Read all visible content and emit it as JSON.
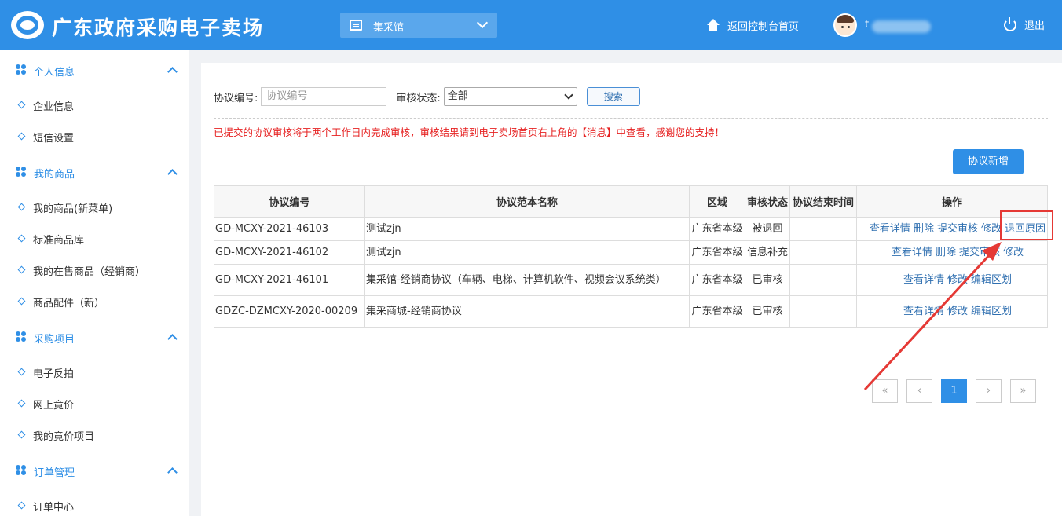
{
  "header": {
    "site_title": "广东政府采购电子卖场",
    "market_select": "集采馆",
    "home_link": "返回控制台首页",
    "username": "t",
    "logout": "退出"
  },
  "sidebar": {
    "groups": [
      {
        "title": "个人信息",
        "items": [
          "企业信息",
          "短信设置"
        ]
      },
      {
        "title": "我的商品",
        "items": [
          "我的商品(新菜单)",
          "标准商品库",
          "我的在售商品（经销商）",
          "商品配件（新）"
        ]
      },
      {
        "title": "采购项目",
        "items": [
          "电子反拍",
          "网上竟价",
          "我的竟价项目"
        ]
      },
      {
        "title": "订单管理",
        "items": [
          "订单中心"
        ]
      }
    ]
  },
  "filter": {
    "agreement_no_label": "协议编号:",
    "agreement_no_placeholder": "协议编号",
    "status_label": "审核状态:",
    "status_value": "全部",
    "search_button": "搜索"
  },
  "notice": "已提交的协议审核将于两个工作日内完成审核，审核结果请到电子卖场首页右上角的【消息】中查看，感谢您的支持！",
  "add_button": "协议新增",
  "table": {
    "headers": [
      "协议编号",
      "协议范本名称",
      "区域",
      "审核状态",
      "协议结束时间",
      "操作"
    ],
    "rows": [
      {
        "no": "GD-MCXY-2021-46103",
        "name": "测试zjn",
        "region": "广东省本级",
        "status": "被退回",
        "end": "",
        "actions": [
          "查看详情",
          "删除",
          "提交审核",
          "修改",
          "退回原因"
        ]
      },
      {
        "no": "GD-MCXY-2021-46102",
        "name": "测试zjn",
        "region": "广东省本级",
        "status": "信息补充",
        "end": "",
        "actions": [
          "查看详情",
          "删除",
          "提交审核",
          "修改"
        ]
      },
      {
        "no": "GD-MCXY-2021-46101",
        "name": "集采馆-经销商协议（车辆、电梯、计算机软件、视频会议系统类）",
        "region": "广东省本级",
        "status": "已审核",
        "end": "",
        "actions": [
          "查看详情",
          "修改",
          "编辑区划"
        ]
      },
      {
        "no": "GDZC-DZMCXY-2020-00209",
        "name": "集采商城-经销商协议",
        "region": "广东省本级",
        "status": "已审核",
        "end": "",
        "actions": [
          "查看详情",
          "修改",
          "编辑区划"
        ]
      }
    ]
  },
  "pagination": {
    "first": "«",
    "prev": "‹",
    "current": "1",
    "next": "›",
    "last": "»"
  },
  "annotation_color": "#e53935"
}
